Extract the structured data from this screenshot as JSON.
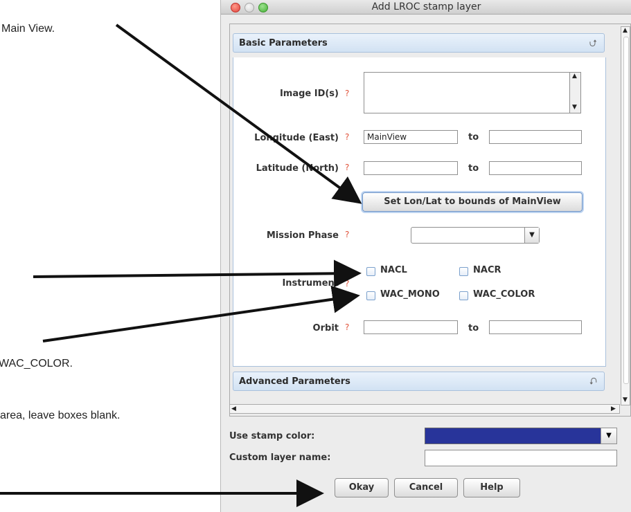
{
  "notes": {
    "main_view": "Main View.",
    "wac_color": "WAC_COLOR.",
    "leave_blank": "area, leave boxes blank."
  },
  "window": {
    "title": "Add LROC stamp layer"
  },
  "basic_panel": {
    "header": "Basic Parameters",
    "image_ids_label": "Image ID(s)",
    "image_ids_value": "",
    "longitude_label": "Longitude (East)",
    "longitude_from": "MainView",
    "longitude_to": "",
    "latitude_label": "Latitude (North)",
    "latitude_from": "",
    "latitude_to": "",
    "to_label": "to",
    "set_bounds_button": "Set Lon/Lat to bounds of MainView",
    "mission_phase_label": "Mission Phase",
    "mission_phase_value": "",
    "instrument_label": "Instrument",
    "instruments": [
      "NACL",
      "NACR",
      "WAC_MONO",
      "WAC_COLOR"
    ],
    "orbit_label": "Orbit",
    "orbit_from": "",
    "orbit_to": "",
    "required_marker": "?"
  },
  "advanced_panel": {
    "header": "Advanced Parameters"
  },
  "bottom": {
    "stamp_color_label": "Use stamp color:",
    "stamp_color_value": "#28349a",
    "custom_name_label": "Custom layer name:",
    "custom_name_value": ""
  },
  "buttons": {
    "okay": "Okay",
    "cancel": "Cancel",
    "help": "Help"
  },
  "colors": {
    "required": "#e0533b",
    "header_blue": "#d2e2f3",
    "arrow": "#111111"
  }
}
